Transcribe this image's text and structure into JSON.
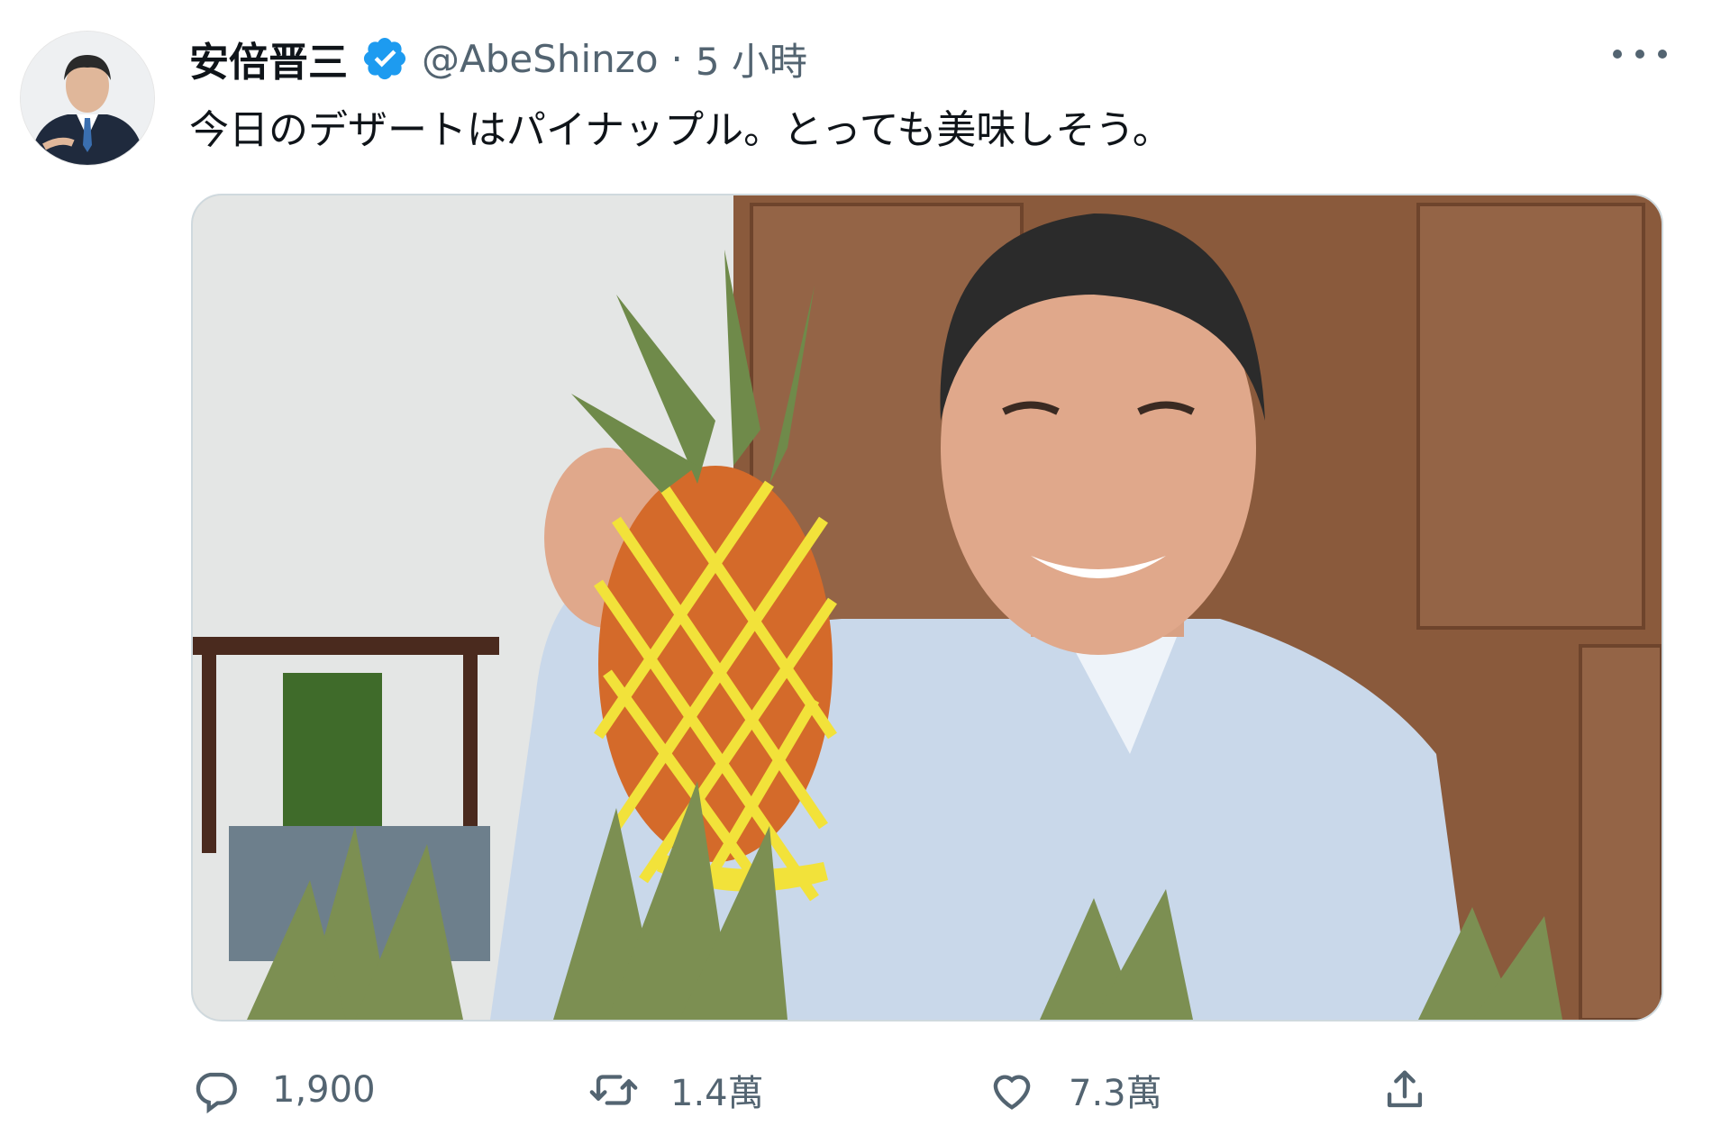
{
  "author": {
    "display_name": "安倍晋三",
    "handle": "@AbeShinzo",
    "separator": "·",
    "time_ago": "5 小時",
    "verified_icon": "verified-badge-icon",
    "verified_color": "#1d9bf0"
  },
  "tweet": {
    "text": "今日のデザートはパイナップル。とっても美味しそう。"
  },
  "actions": {
    "reply_count": "1,900",
    "retweet_count": "1.4萬",
    "like_count": "7.3萬",
    "icons": [
      "reply-icon",
      "retweet-icon",
      "like-icon",
      "share-icon"
    ]
  },
  "colors": {
    "secondary_text": "#536471",
    "primary_text": "#0f1419"
  }
}
